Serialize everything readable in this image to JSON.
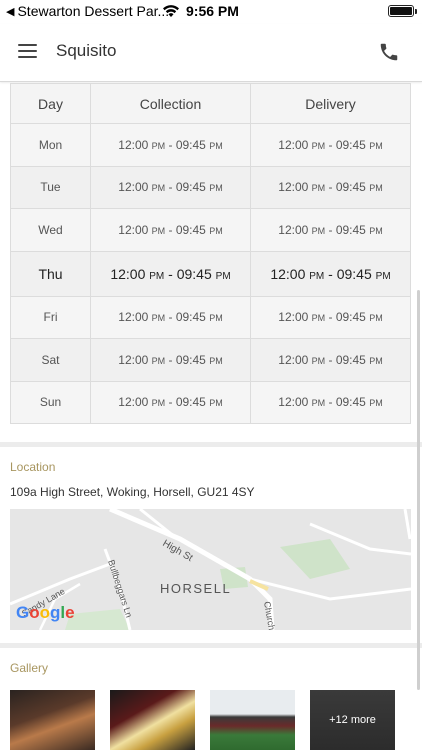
{
  "status_bar": {
    "back_label": "Stewarton Dessert Par...",
    "time": "9:56 PM"
  },
  "nav": {
    "title": "Squisito"
  },
  "hours": {
    "headers": {
      "day": "Day",
      "collection": "Collection",
      "delivery": "Delivery"
    },
    "rows": [
      {
        "day": "Mon",
        "collection": {
          "start": "12:00",
          "start_period": "PM",
          "end": "09:45",
          "end_period": "PM"
        },
        "delivery": {
          "start": "12:00",
          "start_period": "PM",
          "end": "09:45",
          "end_period": "PM"
        }
      },
      {
        "day": "Tue",
        "collection": {
          "start": "12:00",
          "start_period": "PM",
          "end": "09:45",
          "end_period": "PM"
        },
        "delivery": {
          "start": "12:00",
          "start_period": "PM",
          "end": "09:45",
          "end_period": "PM"
        }
      },
      {
        "day": "Wed",
        "collection": {
          "start": "12:00",
          "start_period": "PM",
          "end": "09:45",
          "end_period": "PM"
        },
        "delivery": {
          "start": "12:00",
          "start_period": "PM",
          "end": "09:45",
          "end_period": "PM"
        }
      },
      {
        "day": "Thu",
        "collection": {
          "start": "12:00",
          "start_period": "PM",
          "end": "09:45",
          "end_period": "PM"
        },
        "delivery": {
          "start": "12:00",
          "start_period": "PM",
          "end": "09:45",
          "end_period": "PM"
        }
      },
      {
        "day": "Fri",
        "collection": {
          "start": "12:00",
          "start_period": "PM",
          "end": "09:45",
          "end_period": "PM"
        },
        "delivery": {
          "start": "12:00",
          "start_period": "PM",
          "end": "09:45",
          "end_period": "PM"
        }
      },
      {
        "day": "Sat",
        "collection": {
          "start": "12:00",
          "start_period": "PM",
          "end": "09:45",
          "end_period": "PM"
        },
        "delivery": {
          "start": "12:00",
          "start_period": "PM",
          "end": "09:45",
          "end_period": "PM"
        }
      },
      {
        "day": "Sun",
        "collection": {
          "start": "12:00",
          "start_period": "PM",
          "end": "09:45",
          "end_period": "PM"
        },
        "delivery": {
          "start": "12:00",
          "start_period": "PM",
          "end": "09:45",
          "end_period": "PM"
        }
      }
    ]
  },
  "location": {
    "label": "Location",
    "address": "109a High Street, Woking, Horsell, GU21 4SY",
    "map": {
      "area_name": "HORSELL",
      "streets": [
        "High St",
        "Bullbeggars Ln",
        "Church",
        "Sandy Lane"
      ],
      "provider_logo": [
        "G",
        "o",
        "o",
        "g",
        "l",
        "e"
      ]
    }
  },
  "gallery": {
    "label": "Gallery",
    "more_label": "+12 more"
  },
  "colors": {
    "accent_label": "#a89660",
    "table_border": "#dcdcdc"
  }
}
